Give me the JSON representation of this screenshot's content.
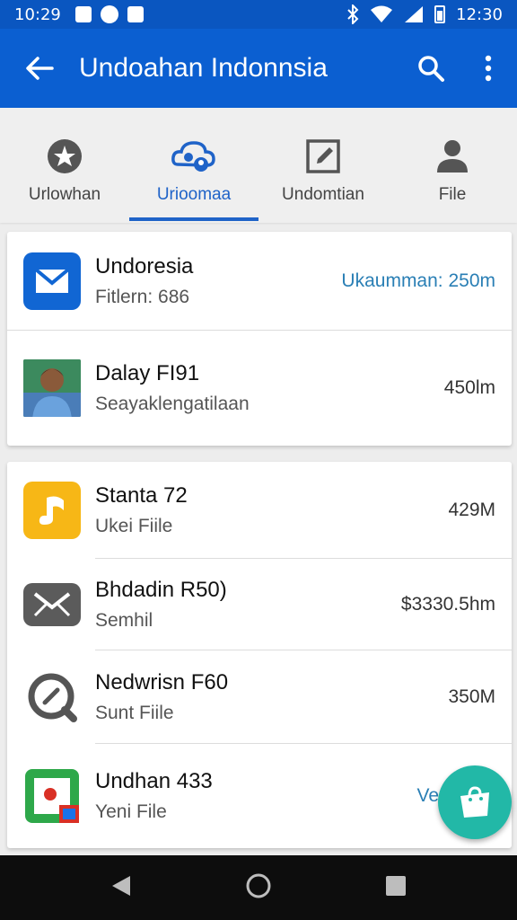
{
  "status_bar": {
    "time_left": "10:29",
    "time_right": "12:30",
    "icons": [
      "notification-icon",
      "messenger-icon",
      "gallery-icon",
      "bluetooth-icon",
      "wifi-icon",
      "signal-icon",
      "battery-icon"
    ]
  },
  "app_bar": {
    "title": "Undoahan Indonnsia",
    "icons": [
      "back-arrow-icon",
      "search-icon",
      "more-vert-icon"
    ]
  },
  "tabs": [
    {
      "label": "Urlowhan",
      "icon": "star-badge-icon",
      "active": false
    },
    {
      "label": "Urioomaa",
      "icon": "cloud-people-icon",
      "active": true
    },
    {
      "label": "Undomtian",
      "icon": "edit-box-icon",
      "active": false
    },
    {
      "label": "File",
      "icon": "person-icon",
      "active": false
    }
  ],
  "list_group_1": [
    {
      "name": "Undoresia",
      "sub": "Fitlern: 686",
      "meta": "Ukaumman: 250m",
      "icon": "mail-app-icon"
    },
    {
      "name": "Dalay FI91",
      "sub": "Seayaklengatilaan",
      "meta": "450lm",
      "icon": "person-photo"
    }
  ],
  "list_group_2": [
    {
      "name": "Stanta 72",
      "sub": "Ukei Fiile",
      "meta": "429M",
      "icon": "music-note-icon"
    },
    {
      "name": "Bhdadin R50)",
      "sub": "Semhil",
      "meta": "$3330.5hm",
      "icon": "envelope-icon"
    },
    {
      "name": "Nedwrisn F60",
      "sub": "Sunt Fiile",
      "meta": "350M",
      "icon": "clock-search-icon"
    },
    {
      "name": "Undhan 433",
      "sub": "Yeni File",
      "meta": "Ver",
      "icon": "maps-app-icon"
    }
  ],
  "fab": {
    "icon": "shopping-bag-icon"
  },
  "nav_bar": {
    "icons": [
      "nav-back-icon",
      "nav-home-icon",
      "nav-recents-icon"
    ]
  },
  "colors": {
    "primary": "#0b5fd1",
    "accent": "#1f63c8",
    "fab": "#22b8a7",
    "meta_accent": "#2a7fb5"
  }
}
